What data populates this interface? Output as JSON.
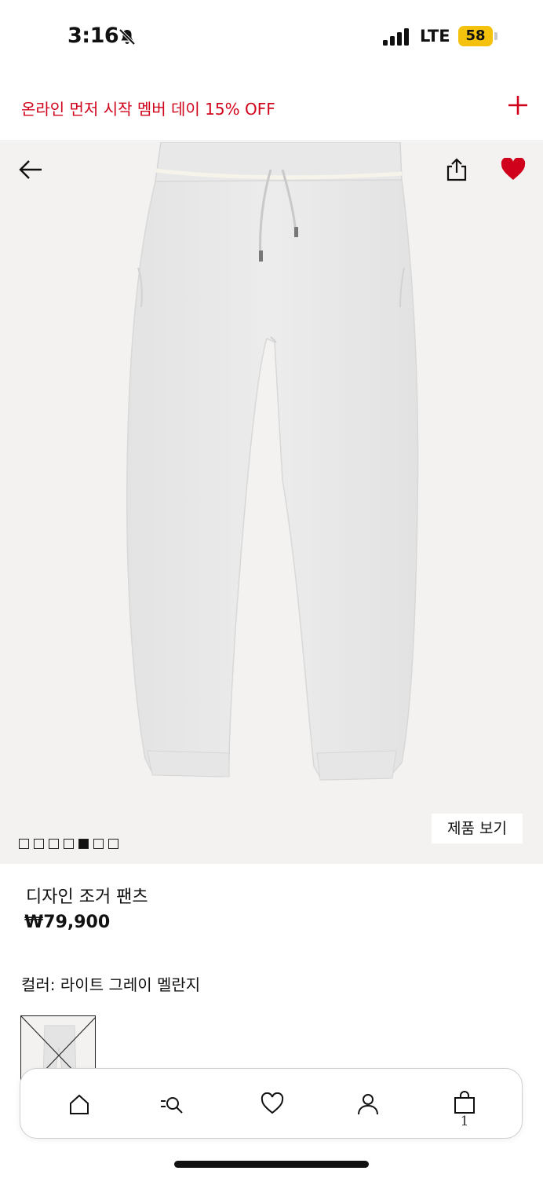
{
  "status": {
    "time": "3:16",
    "network": "LTE",
    "battery": "58"
  },
  "promo": {
    "text": "온라인 먼저 시작 멤버 데이 15% OFF",
    "accent_color": "#d0021b",
    "expand_icon": "plus-icon"
  },
  "gallery": {
    "image_description_icon": "product-photo",
    "back_icon": "arrow-left-icon",
    "share_icon": "share-icon",
    "favorite_icon": "heart-filled-icon",
    "favorite_color": "#d0021b",
    "pagination": {
      "total": 7,
      "active_index": 4
    },
    "view_product_label": "제품 보기"
  },
  "product": {
    "name": "디자인 조거 팬츠",
    "price": "₩79,900",
    "color_label": "컬러: 라이트 그레이 멜란지"
  },
  "bottom_nav": {
    "items": [
      {
        "icon": "home-icon"
      },
      {
        "icon": "search-menu-icon"
      },
      {
        "icon": "heart-icon"
      },
      {
        "icon": "user-icon"
      },
      {
        "icon": "bag-icon"
      }
    ],
    "cart_count": "1"
  }
}
